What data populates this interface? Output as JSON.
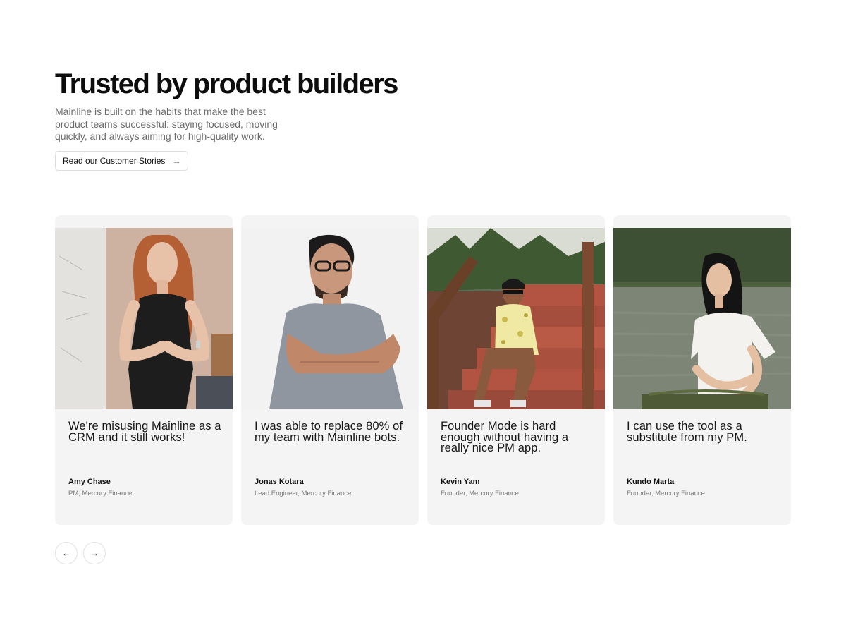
{
  "hero": {
    "title": "Trusted by product builders",
    "description": "Mainline is built on the habits that make the best product teams successful: staying focused, moving quickly, and always aiming for high-quality work.",
    "cta_label": "Read our Customer Stories",
    "cta_icon": "arrow-right-icon"
  },
  "testimonials": [
    {
      "quote": "We're misusing Mainline as a CRM and it still works!",
      "name": "Amy Chase",
      "role": "PM, Mercury Finance",
      "photo": "photo-smiling-woman-red-hair"
    },
    {
      "quote": "I was able to replace 80% of my team with Mainline bots.",
      "name": "Jonas Kotara",
      "role": "Lead Engineer, Mercury Finance",
      "photo": "photo-man-glasses-crossed-arms"
    },
    {
      "quote": "Founder Mode is hard enough without having a really nice PM app.",
      "name": "Kevin Yam",
      "role": "Founder, Mercury Finance",
      "photo": "photo-man-sitting-on-stairs"
    },
    {
      "quote": "I can use the tool as a substitute from my PM.",
      "name": "Kundo Marta",
      "role": "Founder, Mercury Finance",
      "photo": "photo-woman-meditating-by-lake"
    }
  ],
  "carousel": {
    "prev_icon": "arrow-left-icon",
    "next_icon": "arrow-right-icon"
  },
  "colors": {
    "card_background": "#f4f4f4",
    "muted_text": "#6b6b6b",
    "border": "#dcdcdc"
  }
}
